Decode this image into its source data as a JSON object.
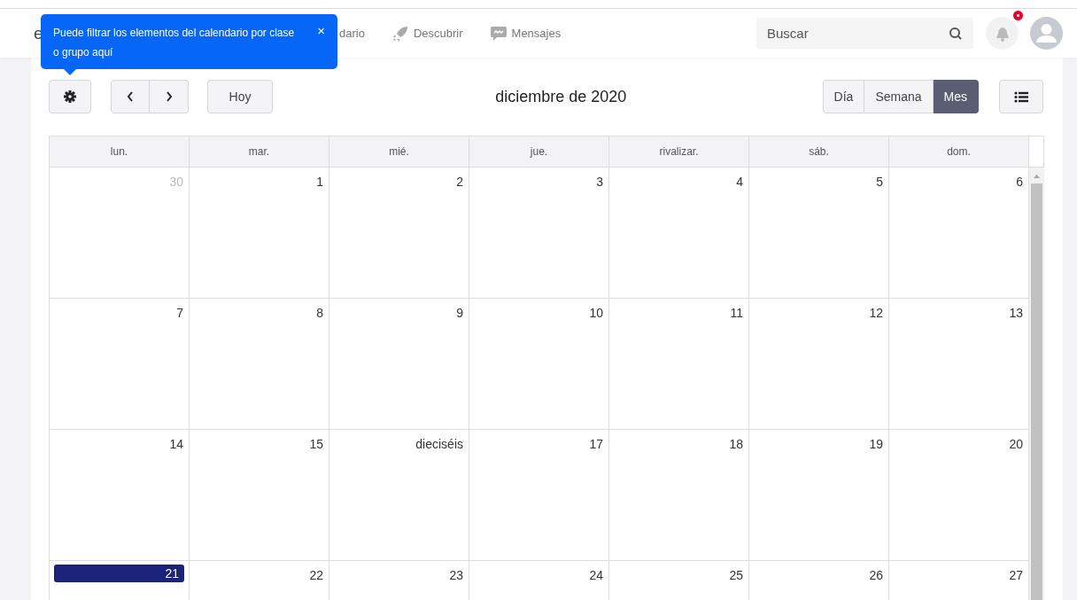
{
  "navbar": {
    "logo": "e",
    "items": [
      {
        "label": "dario",
        "kind": "plain"
      },
      {
        "label": "Descubrir",
        "kind": "rocket"
      },
      {
        "label": "Mensajes",
        "kind": "chat"
      }
    ],
    "search": {
      "placeholder": "Buscar"
    },
    "notifications": {
      "unread": true
    }
  },
  "tooltip": {
    "text": "Puede filtrar los elementos del calendario por clase o grupo aquí",
    "close": "×"
  },
  "toolbar": {
    "today": "Hoy",
    "title": "diciembre de 2020",
    "views": [
      {
        "label": "Día",
        "selected": false
      },
      {
        "label": "Semana",
        "selected": false
      },
      {
        "label": "Mes",
        "selected": true
      }
    ]
  },
  "calendar": {
    "weekdays": [
      "lun.",
      "mar.",
      "mié.",
      "jue.",
      "rivalizar.",
      "sáb.",
      "dom."
    ],
    "weeks": [
      [
        {
          "day": "30",
          "other_month": true,
          "today": false
        },
        {
          "day": "1",
          "other_month": false,
          "today": false
        },
        {
          "day": "2",
          "other_month": false,
          "today": false
        },
        {
          "day": "3",
          "other_month": false,
          "today": false
        },
        {
          "day": "4",
          "other_month": false,
          "today": false
        },
        {
          "day": "5",
          "other_month": false,
          "today": false
        },
        {
          "day": "6",
          "other_month": false,
          "today": false
        }
      ],
      [
        {
          "day": "7",
          "other_month": false,
          "today": false
        },
        {
          "day": "8",
          "other_month": false,
          "today": false
        },
        {
          "day": "9",
          "other_month": false,
          "today": false
        },
        {
          "day": "10",
          "other_month": false,
          "today": false
        },
        {
          "day": "11",
          "other_month": false,
          "today": false
        },
        {
          "day": "12",
          "other_month": false,
          "today": false
        },
        {
          "day": "13",
          "other_month": false,
          "today": false
        }
      ],
      [
        {
          "day": "14",
          "other_month": false,
          "today": false
        },
        {
          "day": "15",
          "other_month": false,
          "today": false
        },
        {
          "day": "dieciséis",
          "other_month": false,
          "today": false
        },
        {
          "day": "17",
          "other_month": false,
          "today": false
        },
        {
          "day": "18",
          "other_month": false,
          "today": false
        },
        {
          "day": "19",
          "other_month": false,
          "today": false
        },
        {
          "day": "20",
          "other_month": false,
          "today": false
        }
      ],
      [
        {
          "day": "21",
          "other_month": false,
          "today": true
        },
        {
          "day": "22",
          "other_month": false,
          "today": false
        },
        {
          "day": "23",
          "other_month": false,
          "today": false
        },
        {
          "day": "24",
          "other_month": false,
          "today": false
        },
        {
          "day": "25",
          "other_month": false,
          "today": false
        },
        {
          "day": "26",
          "other_month": false,
          "today": false
        },
        {
          "day": "27",
          "other_month": false,
          "today": false
        }
      ]
    ]
  }
}
